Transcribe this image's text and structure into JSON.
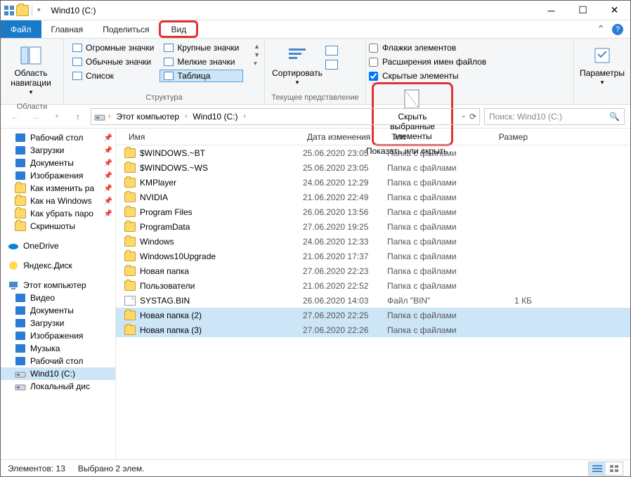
{
  "window": {
    "title": "Wind10 (C:)"
  },
  "tabs": {
    "file": "Файл",
    "home": "Главная",
    "share": "Поделиться",
    "view": "Вид"
  },
  "ribbon": {
    "nav_pane": "Область навигации",
    "group1": "Области",
    "layout": {
      "huge": "Огромные значки",
      "large": "Крупные значки",
      "normal": "Обычные значки",
      "small": "Мелкие значки",
      "list": "Список",
      "table": "Таблица"
    },
    "group2": "Структура",
    "sort": "Сортировать",
    "group3": "Текущее представление",
    "chk_flags": "Флажки элементов",
    "chk_ext": "Расширения имен файлов",
    "chk_hidden": "Скрытые элементы",
    "hide_btn": "Скрыть выбранные элементы",
    "group4": "Показать или скрыть",
    "params": "Параметры"
  },
  "address": {
    "seg1": "Этот компьютер",
    "seg2": "Wind10 (C:)",
    "search_placeholder": "Поиск: Wind10 (C:)"
  },
  "nav": {
    "items": [
      {
        "label": "Рабочий стол",
        "icon": "desktop",
        "pin": true
      },
      {
        "label": "Загрузки",
        "icon": "downloads",
        "pin": true
      },
      {
        "label": "Документы",
        "icon": "docs",
        "pin": true
      },
      {
        "label": "Изображения",
        "icon": "pics",
        "pin": true
      },
      {
        "label": "Как изменить ра",
        "icon": "folder",
        "pin": true
      },
      {
        "label": "Как на Windows",
        "icon": "folder",
        "pin": true
      },
      {
        "label": "Как убрать паро",
        "icon": "folder",
        "pin": true
      },
      {
        "label": "Скриншоты",
        "icon": "folder",
        "pin": false
      }
    ],
    "onedrive": "OneDrive",
    "yadisk": "Яндекс.Диск",
    "thispc": "Этот компьютер",
    "pc_items": [
      {
        "label": "Видео",
        "icon": "video"
      },
      {
        "label": "Документы",
        "icon": "docs"
      },
      {
        "label": "Загрузки",
        "icon": "downloads"
      },
      {
        "label": "Изображения",
        "icon": "pics"
      },
      {
        "label": "Музыка",
        "icon": "music"
      },
      {
        "label": "Рабочий стол",
        "icon": "desktop"
      },
      {
        "label": "Wind10 (C:)",
        "icon": "drive",
        "selected": true
      },
      {
        "label": "Локальный дис",
        "icon": "drive"
      }
    ]
  },
  "columns": {
    "name": "Имя",
    "date": "Дата изменения",
    "type": "Тип",
    "size": "Размер"
  },
  "rows": [
    {
      "name": "$WINDOWS.~BT",
      "date": "25.06.2020 23:05",
      "type": "Папка с файлами",
      "size": "",
      "icon": "folder"
    },
    {
      "name": "$WINDOWS.~WS",
      "date": "25.06.2020 23:05",
      "type": "Папка с файлами",
      "size": "",
      "icon": "folder"
    },
    {
      "name": "KMPlayer",
      "date": "24.06.2020 12:29",
      "type": "Папка с файлами",
      "size": "",
      "icon": "folder"
    },
    {
      "name": "NVIDIA",
      "date": "21.06.2020 22:49",
      "type": "Папка с файлами",
      "size": "",
      "icon": "folder"
    },
    {
      "name": "Program Files",
      "date": "26.06.2020 13:56",
      "type": "Папка с файлами",
      "size": "",
      "icon": "folder"
    },
    {
      "name": "ProgramData",
      "date": "27.06.2020 19:25",
      "type": "Папка с файлами",
      "size": "",
      "icon": "folder"
    },
    {
      "name": "Windows",
      "date": "24.06.2020 12:33",
      "type": "Папка с файлами",
      "size": "",
      "icon": "folder"
    },
    {
      "name": "Windows10Upgrade",
      "date": "21.06.2020 17:37",
      "type": "Папка с файлами",
      "size": "",
      "icon": "folder"
    },
    {
      "name": "Новая папка",
      "date": "27.06.2020 22:23",
      "type": "Папка с файлами",
      "size": "",
      "icon": "folder"
    },
    {
      "name": "Пользователи",
      "date": "21.06.2020 22:52",
      "type": "Папка с файлами",
      "size": "",
      "icon": "folder"
    },
    {
      "name": "SYSTAG.BIN",
      "date": "26.06.2020 14:03",
      "type": "Файл \"BIN\"",
      "size": "1 КБ",
      "icon": "file"
    },
    {
      "name": "Новая папка (2)",
      "date": "27.06.2020 22:25",
      "type": "Папка с файлами",
      "size": "",
      "icon": "folder",
      "selected": true
    },
    {
      "name": "Новая папка (3)",
      "date": "27.06.2020 22:26",
      "type": "Папка с файлами",
      "size": "",
      "icon": "folder",
      "selected": true
    }
  ],
  "status": {
    "count": "Элементов: 13",
    "sel": "Выбрано 2 элем."
  }
}
